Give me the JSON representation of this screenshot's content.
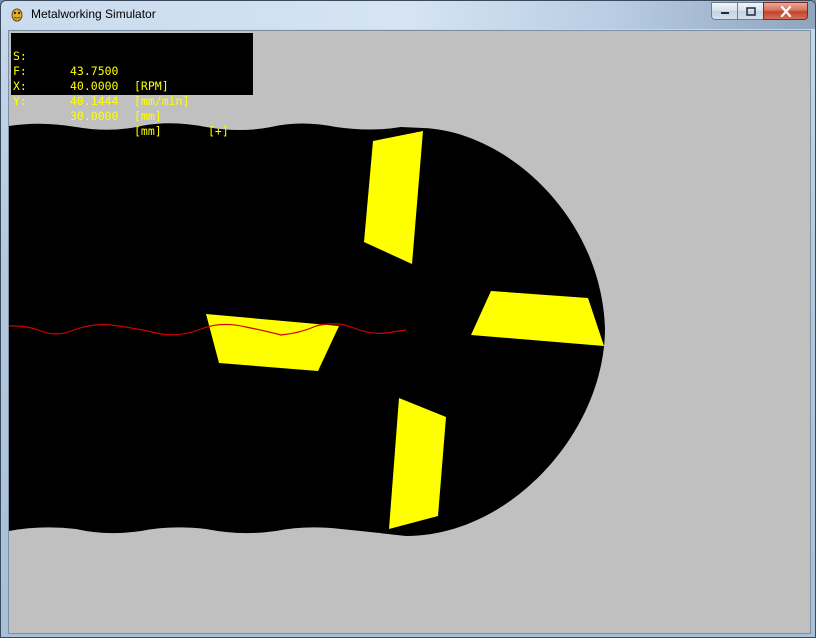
{
  "window": {
    "title": "Metalworking Simulator",
    "icon": "pygame-snake-icon"
  },
  "controls": {
    "minimize_icon": "minimize-icon",
    "maximize_icon": "maximize-icon",
    "close_icon": "close-icon"
  },
  "hud": {
    "rows": [
      {
        "label": "S:",
        "value": "43.7500",
        "unit": "[RPM]",
        "flag": ""
      },
      {
        "label": "F:",
        "value": "40.0000",
        "unit": "[mm/min]",
        "flag": ""
      },
      {
        "label": "X:",
        "value": "40.1444",
        "unit": "[mm]",
        "flag": "[+]"
      },
      {
        "label": "Y:",
        "value": "30.0000",
        "unit": "[mm]",
        "flag": ""
      }
    ]
  },
  "colors": {
    "background": "#c0c0c0",
    "material_cut": "#000000",
    "cutter_inserts": "#ffff00",
    "toolpath": "#d40000",
    "hud_text": "#ffff00"
  }
}
